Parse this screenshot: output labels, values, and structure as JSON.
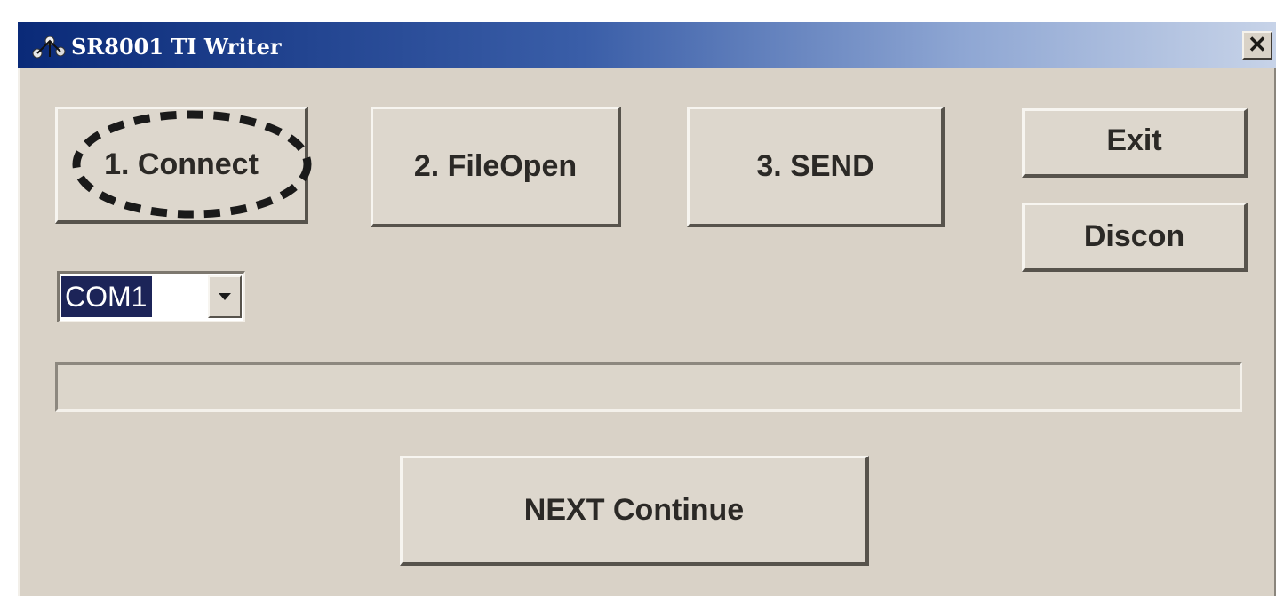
{
  "window": {
    "title": "SR8001 TI Writer",
    "close_glyph": "✕"
  },
  "buttons": {
    "connect_label": "1. Connect",
    "fileopen_label": "2. FileOpen",
    "send_label": "3. SEND",
    "exit_label": "Exit",
    "discon_label": "Discon",
    "next_label": "NEXT Continue"
  },
  "port_select": {
    "selected": "COM1"
  },
  "progress": {
    "value": 0
  },
  "icons": {
    "app": "app-icon",
    "close": "close-icon",
    "dropdown": "chevron-down-icon"
  },
  "colors": {
    "title_gradient_start": "#0a2a78",
    "title_gradient_end": "#c7d3e8",
    "face": "#d9d2c7",
    "selection": "#1c2458",
    "highlight_outline": "#1a1a1a"
  }
}
